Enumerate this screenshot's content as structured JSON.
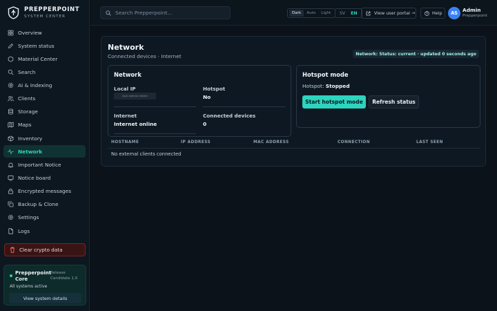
{
  "brand": {
    "name": "PREPPERPOINT",
    "subtitle": "SYSTEM CENTER"
  },
  "sidebar": {
    "items": [
      {
        "label": "Overview",
        "icon": "grid-icon",
        "active": false
      },
      {
        "label": "System status",
        "icon": "pencil-icon",
        "active": false
      },
      {
        "label": "Material Center",
        "icon": "hexagon-icon",
        "active": false
      },
      {
        "label": "Search",
        "icon": "search-icon",
        "active": false
      },
      {
        "label": "AI & Indexing",
        "icon": "gear-icon",
        "active": false
      },
      {
        "label": "Clients",
        "icon": "users-icon",
        "active": false
      },
      {
        "label": "Storage",
        "icon": "database-icon",
        "active": false
      },
      {
        "label": "Maps",
        "icon": "map-icon",
        "active": false
      },
      {
        "label": "Inventory",
        "icon": "box-icon",
        "active": false
      },
      {
        "label": "Network",
        "icon": "pulse-icon",
        "active": true
      },
      {
        "label": "Important Notice",
        "icon": "bell-icon",
        "active": false
      },
      {
        "label": "Notice board",
        "icon": "board-icon",
        "active": false
      },
      {
        "label": "Encrypted messages",
        "icon": "lock-icon",
        "active": false
      },
      {
        "label": "Backup & Clone",
        "icon": "copy-icon",
        "active": false
      },
      {
        "label": "Settings",
        "icon": "gear-icon",
        "active": false
      },
      {
        "label": "Logs",
        "icon": "document-icon",
        "active": false
      }
    ],
    "clear_label": "Clear crypto data",
    "core": {
      "name": "Prepperpoint Core",
      "release": "Release Candidate 1.0",
      "status": "All systems active",
      "details_label": "View system details"
    }
  },
  "topbar": {
    "search_placeholder": "Search Prepperpoint...",
    "theme": {
      "options": [
        "Dark",
        "Auto",
        "Light"
      ],
      "selected": "Dark"
    },
    "lang": {
      "options": [
        "SV",
        "EN"
      ],
      "selected": "EN"
    },
    "portal_label": "View user portal →",
    "help_label": "Help",
    "user": {
      "initials": "AS",
      "name": "Admin",
      "sub": "Prepperpoint"
    }
  },
  "page": {
    "title": "Network",
    "subtitle": "Connected devices · Internet",
    "status_badge": "Network: Status: current · updated 0 seconds ago"
  },
  "network": {
    "title": "Network",
    "local_ip_label": "Local IP",
    "local_ip_value": "local address hidden",
    "hotspot_label": "Hotspot",
    "hotspot_value": "No",
    "internet_label": "Internet",
    "internet_value": "Internet online",
    "devices_label": "Connected devices",
    "devices_value": "0"
  },
  "hotspot": {
    "title": "Hotspot mode",
    "status_label": "Hotspot:",
    "status_value": "Stopped",
    "start_label": "Start hotspot mode",
    "refresh_label": "Refresh status"
  },
  "clients_table": {
    "columns": [
      "HOSTNAME",
      "IP ADDRESS",
      "MAC ADDRESS",
      "CONNECTION",
      "LAST SEEN"
    ],
    "empty_text": "No external clients connected"
  },
  "colors": {
    "accent": "#2dd4bf",
    "danger": "#7a2323",
    "background": "#0b1219",
    "success": "#34d399"
  }
}
